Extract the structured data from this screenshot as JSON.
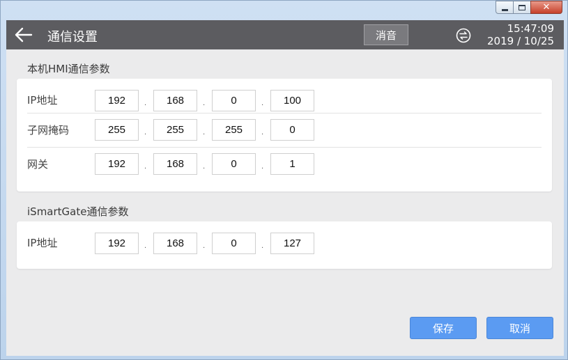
{
  "header": {
    "title": "通信设置",
    "mute_label": "消音",
    "time": "15:47:09",
    "date": "2019 / 10/25"
  },
  "window_controls": {
    "close_glyph": "✕"
  },
  "sections": [
    {
      "title": "本机HMI通信参数",
      "rows": [
        {
          "label": "IP地址",
          "octets": [
            "192",
            "168",
            "0",
            "100"
          ]
        },
        {
          "label": "子网掩码",
          "octets": [
            "255",
            "255",
            "255",
            "0"
          ]
        },
        {
          "label": "网关",
          "octets": [
            "192",
            "168",
            "0",
            "1"
          ]
        }
      ]
    },
    {
      "title": "iSmartGate通信参数",
      "rows": [
        {
          "label": "IP地址",
          "octets": [
            "192",
            "168",
            "0",
            "127"
          ]
        }
      ]
    }
  ],
  "footer": {
    "save_label": "保存",
    "cancel_label": "取消"
  },
  "colors": {
    "header_bg": "#5c5c60",
    "button_accent": "#5b9bf2",
    "page_bg": "#ebebec"
  }
}
